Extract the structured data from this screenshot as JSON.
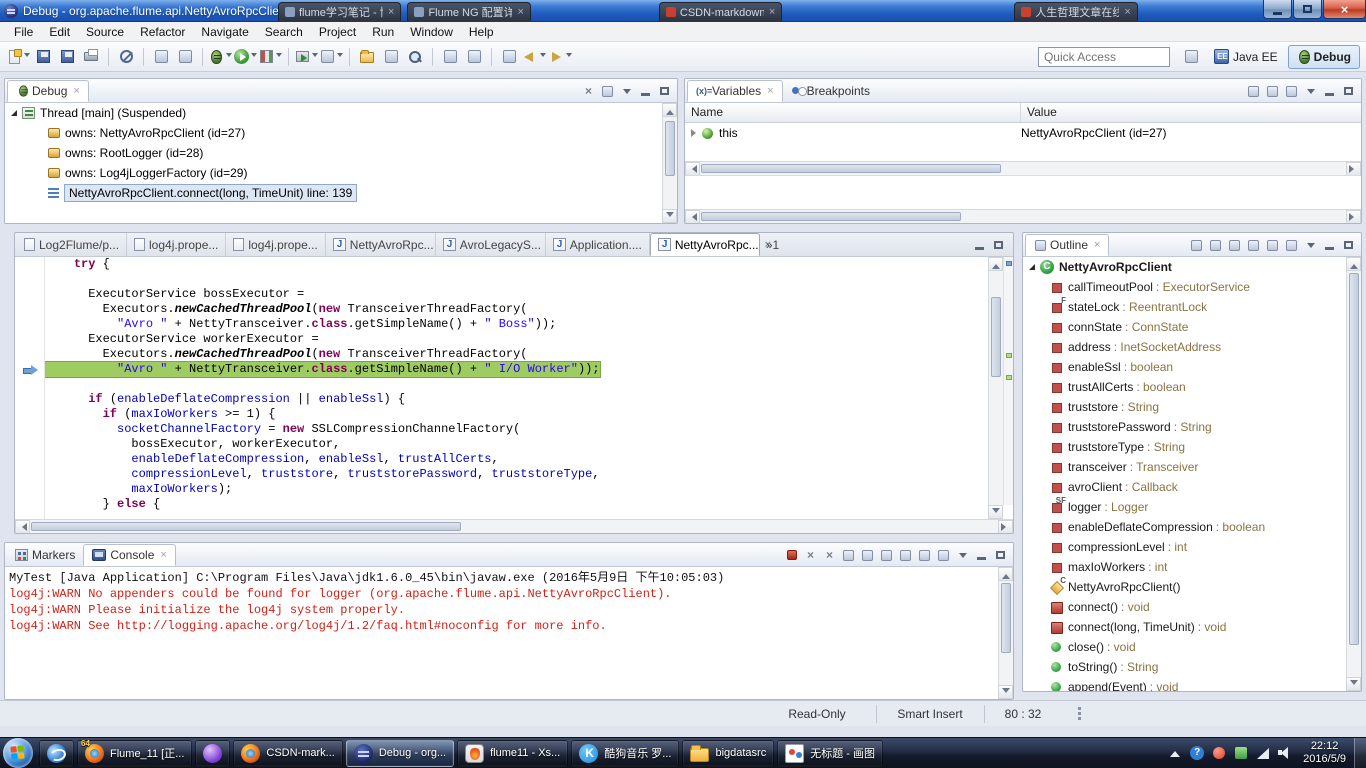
{
  "window": {
    "title": "Debug - org.apache.flume.api.NettyAvroRpcClient - Eclipse"
  },
  "titlebar_tabs": [
    {
      "label": "flume学习笔记 - 博客园"
    },
    {
      "label": "Flume NG 配置详解 - CS..."
    },
    {
      "label": "CSDN-markdown编辑器"
    },
    {
      "label": "人生哲理文章在线阅读"
    }
  ],
  "menubar": {
    "items": [
      "File",
      "Edit",
      "Source",
      "Refactor",
      "Navigate",
      "Search",
      "Project",
      "Run",
      "Window",
      "Help"
    ]
  },
  "toolbar": {
    "quick_access_placeholder": "Quick Access",
    "perspectives": [
      {
        "label": "Java EE",
        "active": false
      },
      {
        "label": "Debug",
        "active": true
      }
    ],
    "groups": [
      [
        {
          "k": "new",
          "dd": true
        },
        {
          "k": "save"
        },
        {
          "k": "save"
        },
        {
          "k": "print"
        }
      ],
      [
        {
          "k": "skip"
        }
      ],
      [
        {
          "k": "gen"
        },
        {
          "k": "gen"
        }
      ],
      [
        {
          "k": "bug",
          "dd": true
        },
        {
          "k": "play",
          "dd": true
        },
        {
          "k": "cov",
          "dd": true
        }
      ],
      [
        {
          "k": "ext",
          "dd": true
        },
        {
          "k": "gen",
          "dd": true
        }
      ],
      [
        {
          "k": "newprj"
        },
        {
          "k": "gen"
        },
        {
          "k": "search"
        }
      ],
      [
        {
          "k": "gen"
        },
        {
          "k": "gen"
        }
      ],
      [
        {
          "k": "gen"
        },
        {
          "k": "back",
          "dd": true
        },
        {
          "k": "fwd",
          "dd": true
        }
      ]
    ]
  },
  "debug_view": {
    "title": "Debug",
    "toolbar_icons": [
      "remove-all-terminated",
      "disconnect",
      "view-menu",
      "minimize",
      "maximize"
    ],
    "rows": [
      {
        "icon": "thread",
        "text": "Thread [main] (Suspended)",
        "indent": 0,
        "expanded": true
      },
      {
        "icon": "own",
        "text": "owns: NettyAvroRpcClient  (id=27)",
        "indent": 1
      },
      {
        "icon": "own",
        "text": "owns: RootLogger  (id=28)",
        "indent": 1
      },
      {
        "icon": "own",
        "text": "owns: Log4jLoggerFactory  (id=29)",
        "indent": 1
      },
      {
        "icon": "frame",
        "text": "NettyAvroRpcClient.connect(long, TimeUnit) line: 139",
        "indent": 1,
        "selected": true
      }
    ]
  },
  "variables_view": {
    "tabs": [
      {
        "label": "Variables",
        "active": true
      },
      {
        "label": "Breakpoints",
        "active": false
      }
    ],
    "toolbar_icons": [
      "show-type-names",
      "show-logical-structure",
      "collapse-all",
      "view-menu",
      "minimize",
      "maximize"
    ],
    "columns": [
      "Name",
      "Value"
    ],
    "rows": [
      {
        "name": "this",
        "value": "NettyAvroRpcClient  (id=27)"
      }
    ]
  },
  "editor": {
    "tabs": [
      {
        "label": "Log2Flume/p...",
        "icon": "file"
      },
      {
        "label": "log4j.prope...",
        "icon": "file"
      },
      {
        "label": "log4j.prope...",
        "icon": "file"
      },
      {
        "label": "NettyAvroRpc...",
        "icon": "java"
      },
      {
        "label": "AvroLegacyS...",
        "icon": "java"
      },
      {
        "label": "Application....",
        "icon": "java"
      },
      {
        "label": "NettyAvroRpc...",
        "icon": "java",
        "active": true
      }
    ],
    "overflow_label": "»1",
    "code_lines": [
      {
        "tokens": [
          [
            "p",
            "    "
          ],
          [
            "k",
            "try"
          ],
          [
            "p",
            " {"
          ]
        ]
      },
      {
        "tokens": []
      },
      {
        "tokens": [
          [
            "p",
            "      ExecutorService bossExecutor ="
          ]
        ]
      },
      {
        "tokens": [
          [
            "p",
            "        Executors."
          ],
          [
            "m",
            "newCachedThreadPool"
          ],
          [
            "p",
            "("
          ],
          [
            "k",
            "new"
          ],
          [
            "p",
            " TransceiverThreadFactory("
          ]
        ]
      },
      {
        "tokens": [
          [
            "p",
            "          "
          ],
          [
            "s",
            "\"Avro \""
          ],
          [
            "p",
            " + NettyTransceiver."
          ],
          [
            "k",
            "class"
          ],
          [
            "p",
            ".getSimpleName() + "
          ],
          [
            "s",
            "\" Boss\""
          ],
          [
            "p",
            "));"
          ]
        ]
      },
      {
        "tokens": [
          [
            "p",
            "      ExecutorService workerExecutor ="
          ]
        ]
      },
      {
        "tokens": [
          [
            "p",
            "        Executors."
          ],
          [
            "m",
            "newCachedThreadPool"
          ],
          [
            "p",
            "("
          ],
          [
            "k",
            "new"
          ],
          [
            "p",
            " TransceiverThreadFactory("
          ]
        ]
      },
      {
        "current": true,
        "tokens": [
          [
            "p",
            "          "
          ],
          [
            "s",
            "\"Avro \""
          ],
          [
            "p",
            " + NettyTransceiver."
          ],
          [
            "k",
            "class"
          ],
          [
            "p",
            ".getSimpleName() + "
          ],
          [
            "s",
            "\" I/O Worker\""
          ],
          [
            "p",
            "));"
          ]
        ]
      },
      {
        "tokens": []
      },
      {
        "tokens": [
          [
            "p",
            "      "
          ],
          [
            "k",
            "if"
          ],
          [
            "p",
            " ("
          ],
          [
            "f",
            "enableDeflateCompression"
          ],
          [
            "p",
            " || "
          ],
          [
            "f",
            "enableSsl"
          ],
          [
            "p",
            ") {"
          ]
        ]
      },
      {
        "tokens": [
          [
            "p",
            "        "
          ],
          [
            "k",
            "if"
          ],
          [
            "p",
            " ("
          ],
          [
            "f",
            "maxIoWorkers"
          ],
          [
            "p",
            " >= 1) {"
          ]
        ]
      },
      {
        "tokens": [
          [
            "p",
            "          "
          ],
          [
            "f",
            "socketChannelFactory"
          ],
          [
            "p",
            " = "
          ],
          [
            "k",
            "new"
          ],
          [
            "p",
            " SSLCompressionChannelFactory("
          ]
        ]
      },
      {
        "tokens": [
          [
            "p",
            "            bossExecutor, workerExecutor,"
          ]
        ]
      },
      {
        "tokens": [
          [
            "p",
            "            "
          ],
          [
            "f",
            "enableDeflateCompression"
          ],
          [
            "p",
            ", "
          ],
          [
            "f",
            "enableSsl"
          ],
          [
            "p",
            ", "
          ],
          [
            "f",
            "trustAllCerts"
          ],
          [
            "p",
            ","
          ]
        ]
      },
      {
        "tokens": [
          [
            "p",
            "            "
          ],
          [
            "f",
            "compressionLevel"
          ],
          [
            "p",
            ", "
          ],
          [
            "f",
            "truststore"
          ],
          [
            "p",
            ", "
          ],
          [
            "f",
            "truststorePassword"
          ],
          [
            "p",
            ", "
          ],
          [
            "f",
            "truststoreType"
          ],
          [
            "p",
            ","
          ]
        ]
      },
      {
        "tokens": [
          [
            "p",
            "            "
          ],
          [
            "f",
            "maxIoWorkers"
          ],
          [
            "p",
            ");"
          ]
        ]
      },
      {
        "tokens": [
          [
            "p",
            "        } "
          ],
          [
            "k",
            "else"
          ],
          [
            "p",
            " {"
          ]
        ]
      }
    ]
  },
  "outline_view": {
    "title": "Outline",
    "toolbar_icons": [
      "focus",
      "sort",
      "hide-fields",
      "hide-static",
      "hide-non-public",
      "hide-local-types",
      "view-menu",
      "minimize",
      "maximize"
    ],
    "items": [
      {
        "icon": "cls",
        "label": "NettyAvroRpcClient",
        "type": "",
        "deco": "",
        "expanded": true
      },
      {
        "icon": "fld",
        "label": "callTimeoutPool",
        "type": "ExecutorService",
        "deco": ""
      },
      {
        "icon": "fld",
        "label": "stateLock",
        "type": "ReentrantLock",
        "deco": "F"
      },
      {
        "icon": "fld",
        "label": "connState",
        "type": "ConnState",
        "deco": ""
      },
      {
        "icon": "fld",
        "label": "address",
        "type": "InetSocketAddress",
        "deco": ""
      },
      {
        "icon": "fld",
        "label": "enableSsl",
        "type": "boolean",
        "deco": ""
      },
      {
        "icon": "fld",
        "label": "trustAllCerts",
        "type": "boolean",
        "deco": ""
      },
      {
        "icon": "fld",
        "label": "truststore",
        "type": "String",
        "deco": ""
      },
      {
        "icon": "fld",
        "label": "truststorePassword",
        "type": "String",
        "deco": ""
      },
      {
        "icon": "fld",
        "label": "truststoreType",
        "type": "String",
        "deco": ""
      },
      {
        "icon": "fld",
        "label": "transceiver",
        "type": "Transceiver",
        "deco": ""
      },
      {
        "icon": "fld",
        "label": "avroClient",
        "type": "Callback",
        "deco": ""
      },
      {
        "icon": "fld",
        "label": "logger",
        "type": "Logger",
        "deco": "SF"
      },
      {
        "icon": "fld",
        "label": "enableDeflateCompression",
        "type": "boolean",
        "deco": ""
      },
      {
        "icon": "fld",
        "label": "compressionLevel",
        "type": "int",
        "deco": ""
      },
      {
        "icon": "fld",
        "label": "maxIoWorkers",
        "type": "int",
        "deco": ""
      },
      {
        "icon": "ctor",
        "label": "NettyAvroRpcClient()",
        "type": "",
        "deco": "C"
      },
      {
        "icon": "mpr",
        "label": "connect()",
        "type": "void",
        "deco": ""
      },
      {
        "icon": "mpr",
        "label": "connect(long, TimeUnit)",
        "type": "void",
        "deco": ""
      },
      {
        "icon": "mpu",
        "label": "close()",
        "type": "void",
        "deco": ""
      },
      {
        "icon": "mpu",
        "label": "toString()",
        "type": "String",
        "deco": ""
      },
      {
        "icon": "mpu",
        "label": "append(Event)",
        "type": "void",
        "deco": ""
      }
    ]
  },
  "console_view": {
    "tabs": [
      {
        "label": "Markers",
        "active": false
      },
      {
        "label": "Console",
        "active": true
      }
    ],
    "toolbar_icons": [
      "terminate",
      "remove-launch",
      "remove-all-launches",
      "clear-console",
      "scroll-lock",
      "word-wrap",
      "pin-console",
      "display-selected",
      "open-console",
      "view-menu",
      "minimize",
      "maximize"
    ],
    "header": "MyTest [Java Application] C:\\Program Files\\Java\\jdk1.6.0_45\\bin\\javaw.exe (2016年5月9日 下午10:05:03)",
    "lines": [
      "log4j:WARN No appenders could be found for logger (org.apache.flume.api.NettyAvroRpcClient).",
      "log4j:WARN Please initialize the log4j system properly.",
      "log4j:WARN See http://logging.apache.org/log4j/1.2/faq.html#noconfig for more info."
    ]
  },
  "statusbar": {
    "writable": "Read-Only",
    "insert_mode": "Smart Insert",
    "position": "80 : 32"
  },
  "taskbar": {
    "items": [
      {
        "kind": "ie",
        "label": ""
      },
      {
        "kind": "firefox",
        "label": "Flume_11 [正...",
        "badge": "64"
      },
      {
        "kind": "purple",
        "label": ""
      },
      {
        "kind": "firefox",
        "label": "CSDN-mark..."
      },
      {
        "kind": "eclipse",
        "label": "Debug - org...",
        "active": true
      },
      {
        "kind": "xshell",
        "label": "flume11 - Xs..."
      },
      {
        "kind": "kugou",
        "label": "酷狗音乐 罗..."
      },
      {
        "kind": "folder",
        "label": "bigdatasrc"
      },
      {
        "kind": "paint",
        "label": "无标题 - 画图"
      }
    ],
    "clock": {
      "time": "22:12",
      "date": "2016/5/9"
    }
  }
}
